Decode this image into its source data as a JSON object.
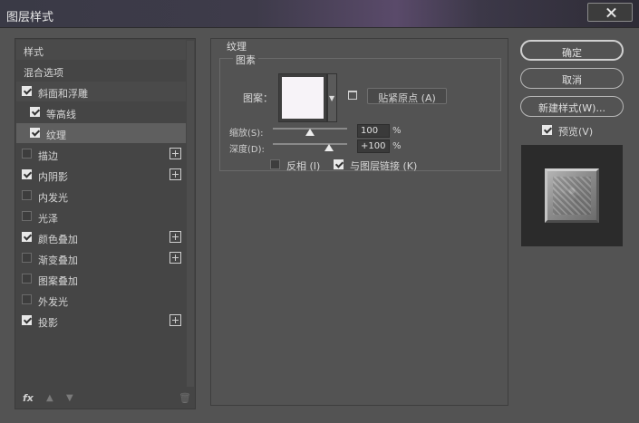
{
  "window": {
    "title": "图层样式"
  },
  "sidebar": {
    "items": [
      {
        "label": "样式",
        "checkbox": false,
        "checked": false,
        "plus": false,
        "indent": false,
        "state": "head"
      },
      {
        "label": "混合选项",
        "checkbox": false,
        "checked": false,
        "plus": false,
        "indent": false,
        "state": "normal"
      },
      {
        "label": "斜面和浮雕",
        "checkbox": true,
        "checked": true,
        "plus": false,
        "indent": false,
        "state": "head"
      },
      {
        "label": "等高线",
        "checkbox": true,
        "checked": true,
        "plus": false,
        "indent": true,
        "state": "normal"
      },
      {
        "label": "纹理",
        "checkbox": true,
        "checked": true,
        "plus": false,
        "indent": true,
        "state": "selected"
      },
      {
        "label": "描边",
        "checkbox": true,
        "checked": false,
        "plus": true,
        "indent": false,
        "state": "normal"
      },
      {
        "label": "内阴影",
        "checkbox": true,
        "checked": true,
        "plus": true,
        "indent": false,
        "state": "normal"
      },
      {
        "label": "内发光",
        "checkbox": true,
        "checked": false,
        "plus": false,
        "indent": false,
        "state": "normal"
      },
      {
        "label": "光泽",
        "checkbox": true,
        "checked": false,
        "plus": false,
        "indent": false,
        "state": "normal"
      },
      {
        "label": "颜色叠加",
        "checkbox": true,
        "checked": true,
        "plus": true,
        "indent": false,
        "state": "normal"
      },
      {
        "label": "渐变叠加",
        "checkbox": true,
        "checked": false,
        "plus": true,
        "indent": false,
        "state": "normal"
      },
      {
        "label": "图案叠加",
        "checkbox": true,
        "checked": false,
        "plus": false,
        "indent": false,
        "state": "normal"
      },
      {
        "label": "外发光",
        "checkbox": true,
        "checked": false,
        "plus": false,
        "indent": false,
        "state": "normal"
      },
      {
        "label": "投影",
        "checkbox": true,
        "checked": true,
        "plus": true,
        "indent": false,
        "state": "normal"
      }
    ],
    "footer": {
      "fx_label": "fx",
      "up_glyph": "▲",
      "down_glyph": "▼",
      "trash_glyph": "🗑"
    }
  },
  "texture": {
    "section_title": "纹理",
    "group_title": "图素",
    "pattern_label": "图案：",
    "snap_button": "贴紧原点 (A)",
    "scale": {
      "label": "缩放(S):",
      "value": "100",
      "unit": "%",
      "level": 0.5
    },
    "depth": {
      "label": "深度(D):",
      "value": "+100",
      "unit": "%",
      "level": 0.75
    },
    "invert": {
      "label": "反相 (I)",
      "checked": false
    },
    "link": {
      "label": "与图层链接 (K)",
      "checked": true
    }
  },
  "buttons": {
    "ok": "确定",
    "cancel": "取消",
    "new_style": "新建样式(W)..."
  },
  "preview": {
    "label": "预览(V)",
    "checked": true
  }
}
